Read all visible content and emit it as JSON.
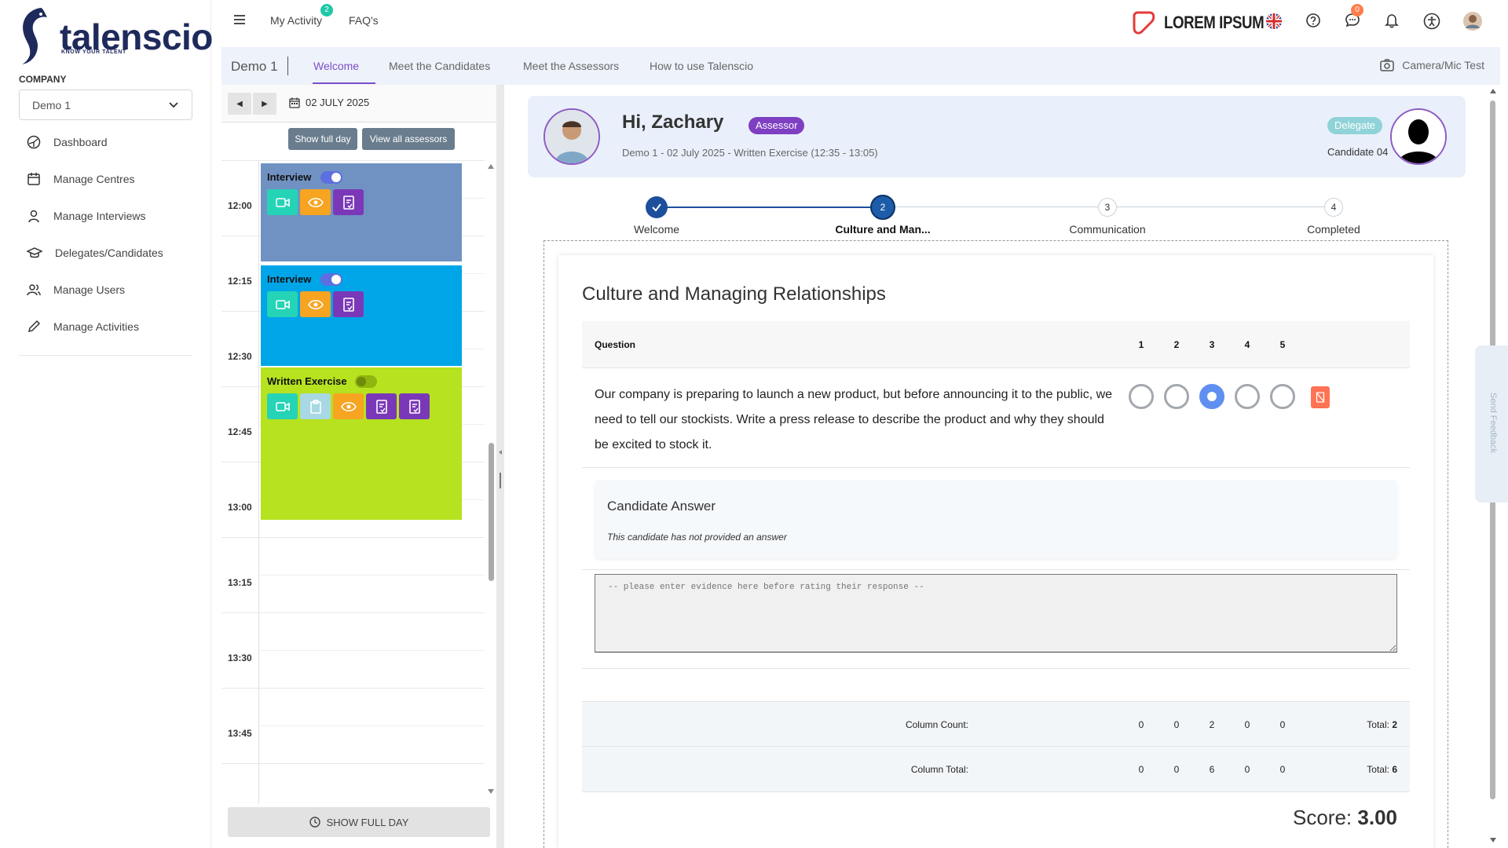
{
  "sidebar": {
    "logo_text": "talenscio",
    "logo_tagline": "KNOW YOUR TALENT",
    "company_label": "COMPANY",
    "company_value": "Demo 1",
    "nav": [
      {
        "label": "Dashboard",
        "icon": "dashboard-icon"
      },
      {
        "label": "Manage Centres",
        "icon": "calendar-icon"
      },
      {
        "label": "Manage Interviews",
        "icon": "user-icon"
      },
      {
        "label": "Delegates/Candidates",
        "icon": "graduation-cap-icon"
      },
      {
        "label": "Manage Users",
        "icon": "users-icon"
      },
      {
        "label": "Manage Activities",
        "icon": "pencil-icon"
      }
    ]
  },
  "topbar": {
    "my_activity": "My Activity",
    "my_activity_count": "2",
    "faqs": "FAQ's",
    "brand": "LOREM IPSUM",
    "messages_count": "0"
  },
  "tabs": {
    "title": "Demo 1",
    "items": [
      "Welcome",
      "Meet the Candidates",
      "Meet the Assessors",
      "How to use Talenscio"
    ],
    "active": "Welcome",
    "camera_test": "Camera/Mic Test"
  },
  "calendar": {
    "date": "02 JULY 2025",
    "show_full_day_btn": "Show full day",
    "view_all_btn": "View all assessors",
    "times": [
      "12:00",
      "12:15",
      "12:30",
      "12:45",
      "13:00",
      "13:15",
      "13:30",
      "13:45"
    ],
    "events": [
      {
        "title": "Interview",
        "color": "#7092c2",
        "toggle": "on"
      },
      {
        "title": "Interview",
        "color": "#00a5e8",
        "toggle": "on"
      },
      {
        "title": "Written Exercise",
        "color": "#b6e21f",
        "toggle": "off"
      }
    ],
    "show_full_day_bottom": "SHOW FULL DAY"
  },
  "assessor": {
    "greeting": "Hi, Zachary",
    "role": "Assessor",
    "subtitle": "Demo 1 - 02 July 2025 - Written Exercise (12:35 - 13:05)",
    "delegate_badge": "Delegate",
    "candidate": "Candidate 04"
  },
  "steps": [
    {
      "num": "1",
      "label": "Welcome",
      "state": "done"
    },
    {
      "num": "2",
      "label": "Culture and Man...",
      "state": "current"
    },
    {
      "num": "3",
      "label": "Communication",
      "state": "todo"
    },
    {
      "num": "4",
      "label": "Completed",
      "state": "todo"
    }
  ],
  "section": {
    "title": "Culture and Managing Relationships",
    "question_header": "Question",
    "columns": [
      "1",
      "2",
      "3",
      "4",
      "5"
    ],
    "question_text": "Our company is preparing to launch a new product, but before announcing it to the public, we need to tell our stockists. Write a press release to describe the product and why they should be excited to stock it.",
    "selected_rating": 3,
    "answer_title": "Candidate Answer",
    "answer_note": "This candidate has not provided an answer",
    "evidence_placeholder": "-- please enter evidence here before rating their response --",
    "column_count_label": "Column Count:",
    "column_count": [
      "0",
      "0",
      "2",
      "0",
      "0"
    ],
    "column_count_total_label": "Total:",
    "column_count_total": "2",
    "column_total_label": "Column Total:",
    "column_total": [
      "0",
      "0",
      "6",
      "0",
      "0"
    ],
    "column_total_total_label": "Total:",
    "column_total_total": "6",
    "score_label": "Score:",
    "score": "3.00"
  },
  "feedback_tab": "Send Feedback"
}
